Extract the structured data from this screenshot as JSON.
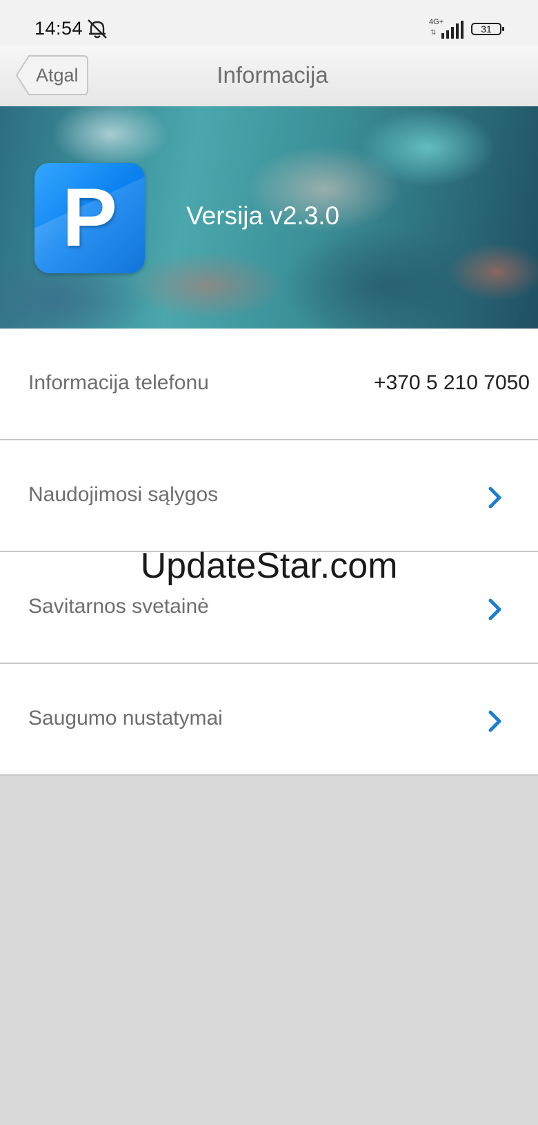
{
  "status_bar": {
    "time": "14:54",
    "network": "4G+",
    "network_arrows": "⇅",
    "battery": "31",
    "icons": [
      "bell-muted-icon",
      "signal-icon",
      "battery-icon"
    ]
  },
  "header": {
    "back_label": "Atgal",
    "title": "Informacija"
  },
  "hero": {
    "logo_letter": "P",
    "version": "Versija v2.3.0"
  },
  "list": {
    "items": [
      {
        "label": "Informacija telefonu",
        "value": "+370 5 210 7050"
      },
      {
        "label": "Naudojimosi sąlygos",
        "icon": "chevron-right-icon"
      },
      {
        "label": "Savitarnos svetainė",
        "icon": "chevron-right-icon"
      },
      {
        "label": "Saugumo nustatymai",
        "icon": "chevron-right-icon"
      }
    ]
  },
  "watermark": "UpdateStar.com",
  "colors": {
    "accent": "#1a7fd4",
    "logo": "#0b82f0",
    "background": "#d9d9d9"
  }
}
